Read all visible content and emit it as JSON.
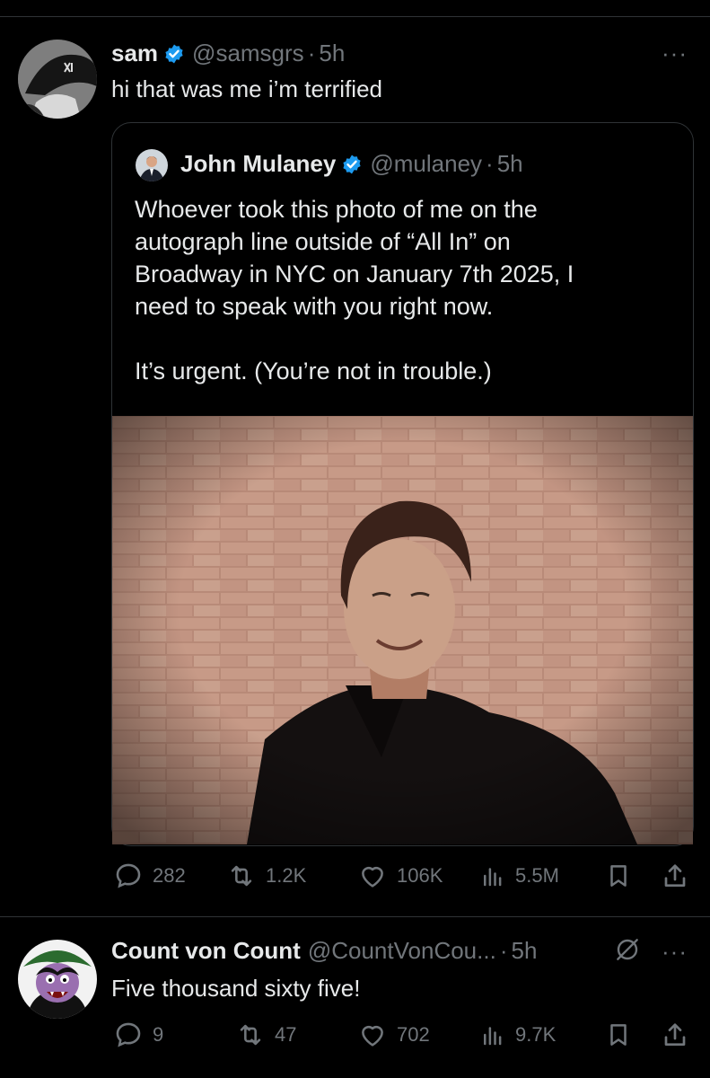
{
  "reply_tweet": {
    "name": "sam",
    "handle": "@samsgrs",
    "time": "5h",
    "text": "hi that was me i’m terrified",
    "more": "···",
    "stats": {
      "replies": "282",
      "retweets": "1.2K",
      "likes": "106K",
      "views": "5.5M"
    }
  },
  "quoted_tweet": {
    "name": "John Mulaney",
    "handle": "@mulaney",
    "time": "5h",
    "text_lines": [
      "Whoever took this photo of me on the",
      "autograph line outside of “All In” on",
      "Broadway in NYC on January 7th 2025, I",
      "need to speak with you right now."
    ],
    "text_second": "It’s urgent. (You’re not in trouble.)"
  },
  "second_tweet": {
    "name": "Count von Count",
    "handle": "@CountVonCou...",
    "time": "5h",
    "text": "Five thousand sixty five!",
    "more": "···",
    "stats": {
      "replies": "9",
      "retweets": "47",
      "likes": "702",
      "views": "9.7K"
    }
  },
  "colors": {
    "background": "#000000",
    "text": "#e7e9ea",
    "secondary": "#71767b",
    "verified": "#1d9bf0",
    "border": "#2f3336"
  }
}
